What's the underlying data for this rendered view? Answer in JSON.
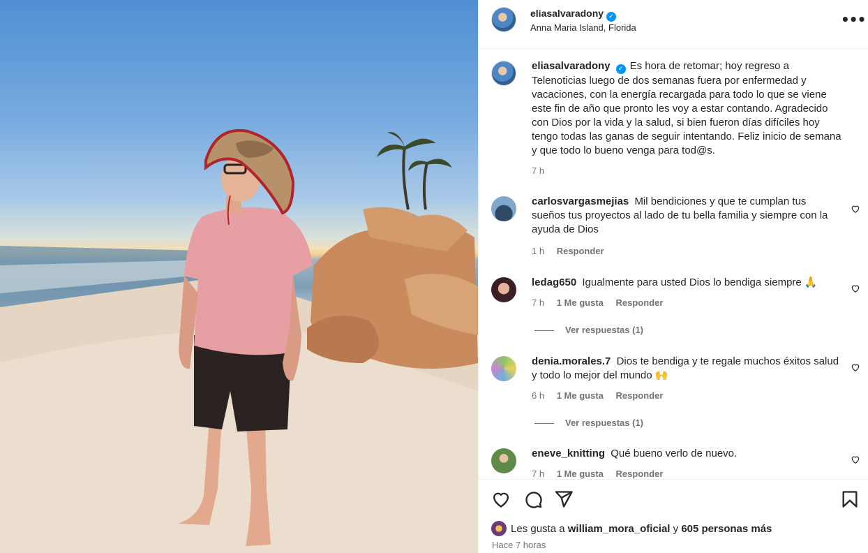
{
  "post": {
    "username": "eliasalvaradony",
    "location": "Anna Maria Island, Florida",
    "verified_icon": "check",
    "caption": "Es hora de retomar; hoy regreso a Telenoticias luego de dos semanas fuera por enfermedad y vacaciones, con la energía recargada para todo lo que se viene este fin de año que pronto les voy a estar contando. Agradecido con Dios por la vida y la salud, si bien fueron días difíciles hoy tengo todas las ganas de seguir intentando. Feliz inicio de semana y que todo lo bueno venga para tod@s.",
    "caption_time": "7 h"
  },
  "comments": [
    {
      "username": "carlosvargasmejias",
      "text": "Mil bendiciones y que te cumplan tus sueños tus proyectos al lado de tu bella familia y siempre con la ayuda de Dios",
      "time": "1 h",
      "likes": "",
      "reply_label": "Responder",
      "view_replies": ""
    },
    {
      "username": "ledag650",
      "text": "Igualmente para usted Dios lo bendiga siempre 🙏",
      "time": "7 h",
      "likes": "1 Me gusta",
      "reply_label": "Responder",
      "view_replies": "Ver respuestas (1)"
    },
    {
      "username": "denia.morales.7",
      "text": "Dios te bendiga y te regale muchos éxitos salud y todo lo mejor del mundo 🙌",
      "time": "6 h",
      "likes": "1 Me gusta",
      "reply_label": "Responder",
      "view_replies": "Ver respuestas (1)"
    },
    {
      "username": "eneve_knitting",
      "text": "Qué bueno verlo de nuevo.",
      "time": "7 h",
      "likes": "1 Me gusta",
      "reply_label": "Responder",
      "view_replies": ""
    }
  ],
  "likes_summary": {
    "prefix": "Les gusta a ",
    "user": "william_mora_oficial",
    "joiner": " y ",
    "others": "605 personas más"
  },
  "posted_time": "Hace 7 horas",
  "colors": {
    "verified": "#0095f6",
    "secondary_text": "#737373",
    "primary_text": "#262626"
  }
}
